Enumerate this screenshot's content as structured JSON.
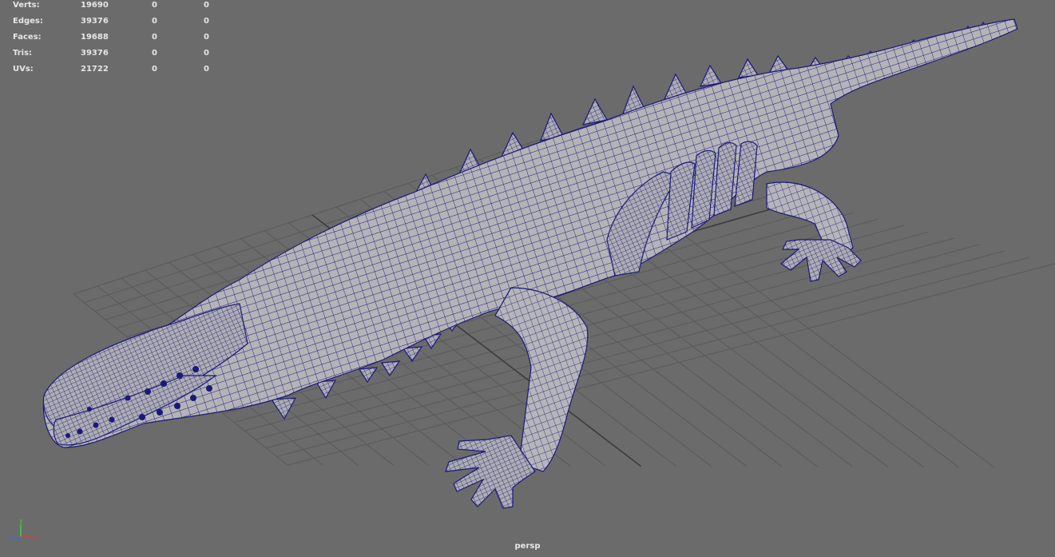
{
  "hud": {
    "rows": [
      {
        "label": "Verts:",
        "total": "19690",
        "selected": "0",
        "components": "0"
      },
      {
        "label": "Edges:",
        "total": "39376",
        "selected": "0",
        "components": "0"
      },
      {
        "label": "Faces:",
        "total": "19688",
        "selected": "0",
        "components": "0"
      },
      {
        "label": "Tris:",
        "total": "39376",
        "selected": "0",
        "components": "0"
      },
      {
        "label": "UVs:",
        "total": "21722",
        "selected": "0",
        "components": "0"
      }
    ]
  },
  "camera": {
    "name": "persp"
  },
  "axis_gizmo": {
    "x": "x",
    "y": "y",
    "z": "z"
  },
  "colors": {
    "background": "#6b6b6b",
    "grid": "#595959",
    "grid_axis": "#3c3c3c",
    "mesh_fill": "#b3b3b7",
    "wireframe": "#1a1a78",
    "hud_text": "#e6e6e6",
    "axis_x": "#e03a3a",
    "axis_y": "#3ad03a",
    "axis_z": "#3a6ae0"
  },
  "icons": {
    "axis_gizmo": "xyz-axis-icon"
  }
}
